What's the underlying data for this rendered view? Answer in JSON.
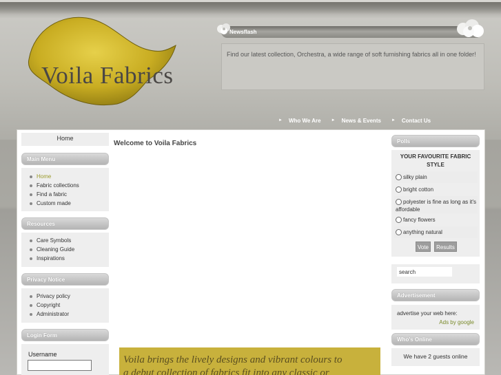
{
  "brand": {
    "logo_text": "Voila Fabrics"
  },
  "newsflash": {
    "title": "Newsflash",
    "text": "Find our latest collection, Orchestra, a wide range of soft furnishing fabrics all in one folder!"
  },
  "top_nav": [
    {
      "label": "Who We Are"
    },
    {
      "label": "News & Events"
    },
    {
      "label": "Contact Us"
    }
  ],
  "home_tab": "Home",
  "main_menu": {
    "title": "Main Menu",
    "items": [
      "Home",
      "Fabric collections",
      "Find a fabric",
      "Custom made"
    ]
  },
  "resources": {
    "title": "Resources",
    "items": [
      "Care Symbols",
      "Cleaning Guide",
      "Inspirations"
    ]
  },
  "privacy": {
    "title": "Privacy Notice",
    "items": [
      "Privacy policy",
      "Copyright",
      "Administrator"
    ]
  },
  "login": {
    "title": "Login Form",
    "username_label": "Username"
  },
  "main": {
    "title": "Welcome to Voila Fabrics",
    "banner_line1": "Voila brings the lively designs and vibrant colours to",
    "banner_line2": "a debut collection of fabrics fit into any classic or"
  },
  "polls": {
    "title": "Polls",
    "question": "YOUR FAVOURITE FABRIC STYLE",
    "options": [
      "silky plain",
      "bright cotton",
      "polyester is fine as long as it's affordable",
      "fancy flowers",
      "anything natural"
    ],
    "vote_label": "Vote",
    "results_label": "Results"
  },
  "search": {
    "value": "search"
  },
  "advertisement": {
    "title": "Advertisement",
    "text": "advertise your web here:",
    "link": "Ads by google"
  },
  "whos_online": {
    "title": "Who's Online",
    "text": "We have 2 guests online"
  },
  "colors": {
    "accent": "#c8b13c",
    "menu_active": "#9a9a2a"
  }
}
